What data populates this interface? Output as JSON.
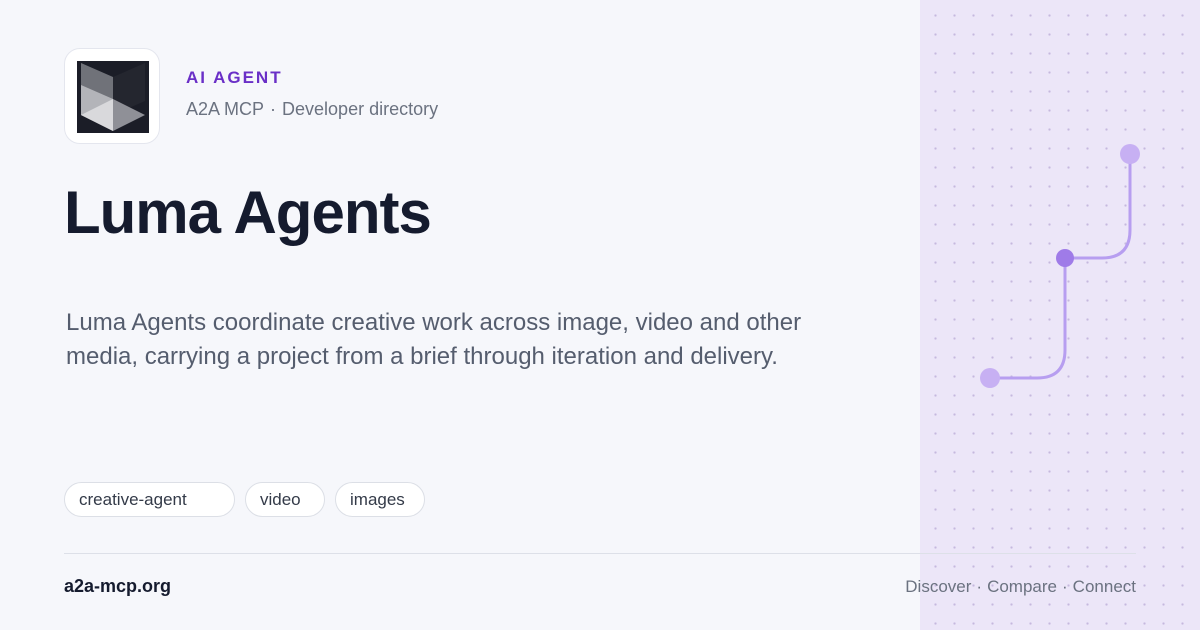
{
  "brand": {
    "eyebrow": "AI AGENT",
    "site_name": "A2A MCP",
    "separator": "·",
    "section": "Developer directory",
    "logo_icon": "hexagon-cube-logo-icon"
  },
  "agent": {
    "name": "Luma Agents",
    "description": "Luma Agents coordinate creative work across image, video and other media, carrying a project from a brief through iteration and delivery.",
    "tags": [
      "creative-agent",
      "video",
      "images"
    ]
  },
  "footer": {
    "domain": "a2a-mcp.org",
    "links": [
      "Discover",
      "Compare",
      "Connect"
    ],
    "separator": "·"
  },
  "decoration": {
    "icon": "connection-path-icon"
  },
  "colors": {
    "accent": "#6a2fc7",
    "panel": "#ece6f8",
    "node": "#a47fe6",
    "background": "#f6f7fb"
  }
}
